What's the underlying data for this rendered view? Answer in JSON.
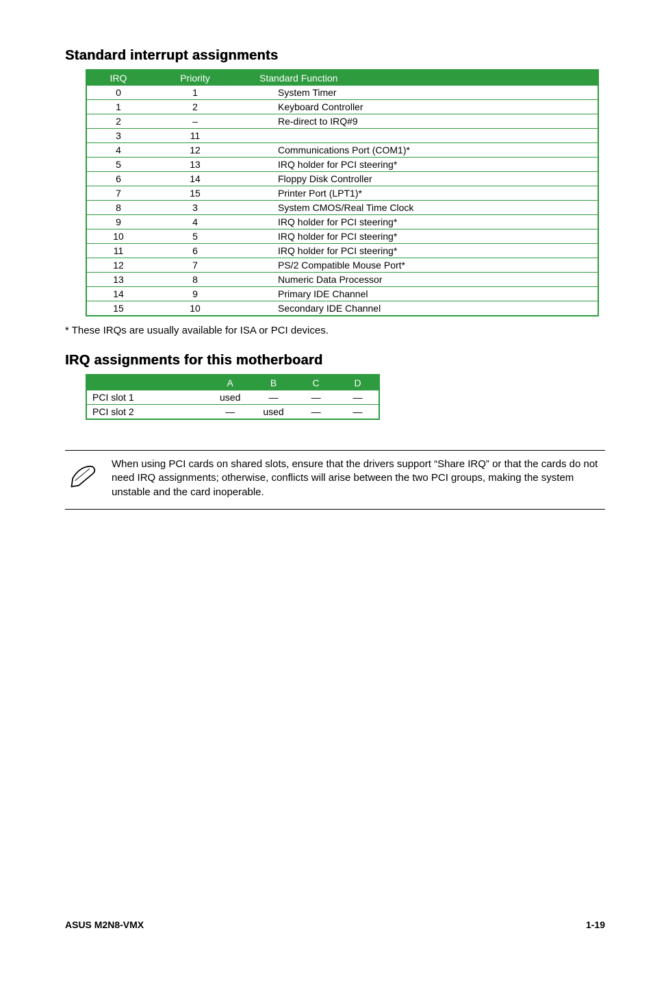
{
  "headings": {
    "interrupt": "Standard interrupt assignments",
    "irq_motherboard": "IRQ assignments for this motherboard"
  },
  "irq_table": {
    "headers": {
      "irq": "IRQ",
      "priority": "Priority",
      "func": "Standard Function"
    },
    "rows": [
      {
        "irq": "0",
        "priority": "1",
        "func": "System Timer"
      },
      {
        "irq": "1",
        "priority": "2",
        "func": "Keyboard Controller"
      },
      {
        "irq": "2",
        "priority": "–",
        "func": "Re-direct to IRQ#9"
      },
      {
        "irq": "3",
        "priority": "11",
        "func": ""
      },
      {
        "irq": "4",
        "priority": "12",
        "func": "Communications Port (COM1)*"
      },
      {
        "irq": "5",
        "priority": "13",
        "func": "IRQ holder for PCI steering*"
      },
      {
        "irq": "6",
        "priority": "14",
        "func": "Floppy Disk Controller"
      },
      {
        "irq": "7",
        "priority": "15",
        "func": "Printer Port (LPT1)*"
      },
      {
        "irq": "8",
        "priority": "3",
        "func": "System CMOS/Real Time Clock"
      },
      {
        "irq": "9",
        "priority": "4",
        "func": "IRQ holder for PCI steering*"
      },
      {
        "irq": "10",
        "priority": "5",
        "func": "IRQ holder for PCI steering*"
      },
      {
        "irq": "11",
        "priority": "6",
        "func": "IRQ holder for PCI steering*"
      },
      {
        "irq": "12",
        "priority": "7",
        "func": "PS/2 Compatible Mouse Port*"
      },
      {
        "irq": "13",
        "priority": "8",
        "func": "Numeric Data Processor"
      },
      {
        "irq": "14",
        "priority": "9",
        "func": "Primary IDE Channel"
      },
      {
        "irq": "15",
        "priority": "10",
        "func": "Secondary IDE Channel"
      }
    ]
  },
  "footnote": "* These IRQs are usually available for ISA or PCI devices.",
  "pci_table": {
    "headers": {
      "a": "A",
      "b": "B",
      "c": "C",
      "d": "D"
    },
    "rows": [
      {
        "name": "PCI slot 1",
        "a": "used",
        "b": "—",
        "c": "—",
        "d": "—"
      },
      {
        "name": "PCI slot 2",
        "a": "—",
        "b": "used",
        "c": "—",
        "d": "—"
      }
    ]
  },
  "note": "When using PCI cards on shared slots, ensure that the drivers support “Share IRQ” or that the cards do not need IRQ assignments; otherwise, conflicts will arise between the two PCI groups, making the system unstable and the card inoperable.",
  "footer": {
    "left": "ASUS M2N8-VMX",
    "right": "1-19"
  }
}
